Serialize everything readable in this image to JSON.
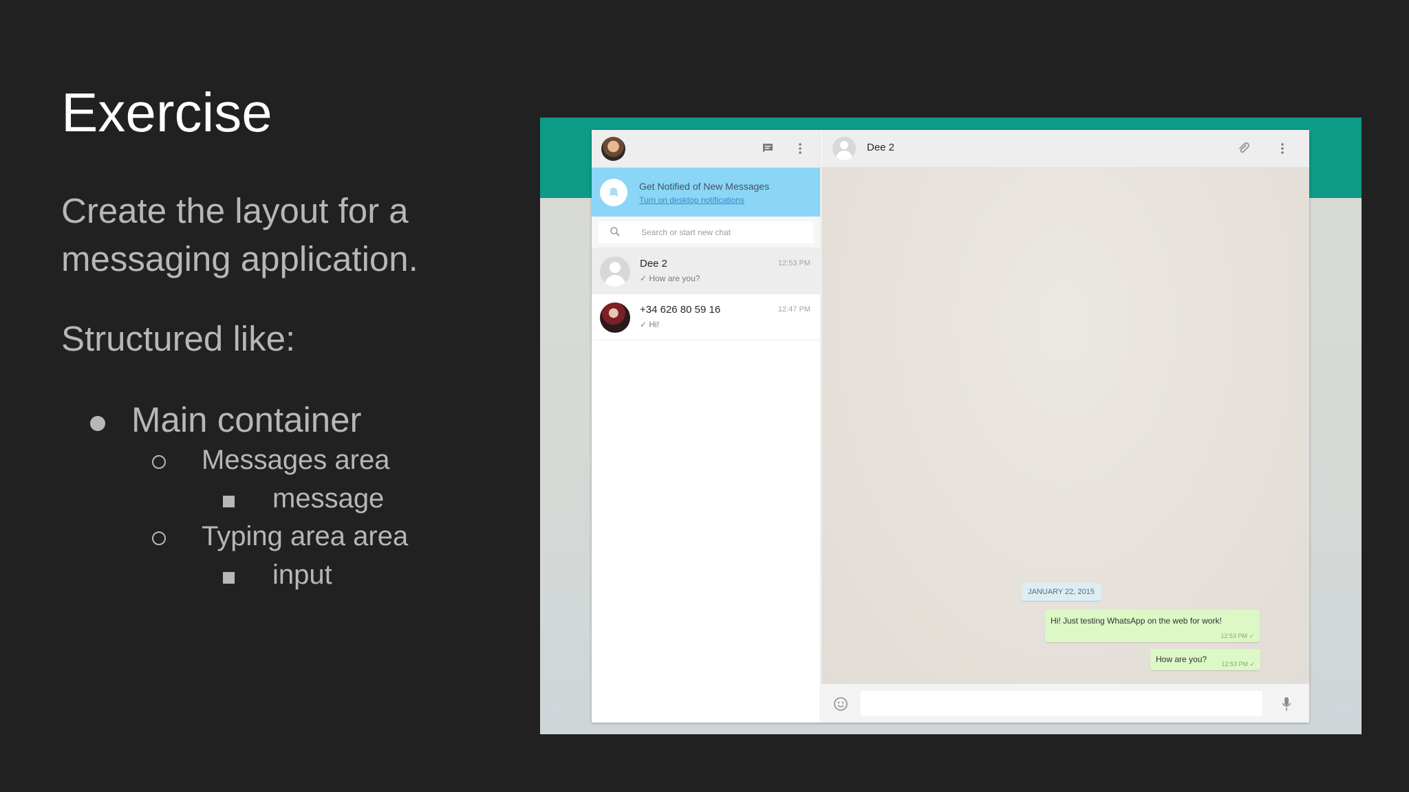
{
  "slide": {
    "title": "Exercise",
    "intro": "Create the layout for a messaging application.",
    "structured_like": "Structured like:",
    "outline": {
      "main": "Main container",
      "messages_area": "Messages area",
      "message": "message",
      "typing_area": "Typing area area",
      "input": "input"
    }
  },
  "app": {
    "sidebar": {
      "notification": {
        "title": "Get Notified of New Messages",
        "link": "Turn on desktop notifications"
      },
      "search_placeholder": "Search or start new chat",
      "chats": [
        {
          "name": "Dee 2",
          "time": "12:53 PM",
          "preview": "✓ How are you?",
          "active": true
        },
        {
          "name": "+34 626 80 59 16",
          "time": "12:47 PM",
          "preview": "✓ Hi!",
          "active": false
        }
      ]
    },
    "conversation": {
      "contact_name": "Dee 2",
      "date_divider": "JANUARY 22, 2015",
      "messages": [
        {
          "text": "Hi! Just testing WhatsApp on the web for work!",
          "time": "12:53 PM ✓"
        },
        {
          "text": "How are you?",
          "time": "12:53 PM ✓"
        }
      ],
      "composer_value": ""
    }
  },
  "colors": {
    "slide_bg": "#212121",
    "title": "#ffffff",
    "body_text": "#b7b7b7",
    "whatsapp_teal": "#0d9a87",
    "notification_bg": "#8bd6f6",
    "outgoing_bubble": "#dcf8c6"
  },
  "icons": [
    "new-chat-icon",
    "menu-icon",
    "bell-off-icon",
    "search-icon",
    "paperclip-icon",
    "emoji-icon",
    "microphone-icon"
  ]
}
